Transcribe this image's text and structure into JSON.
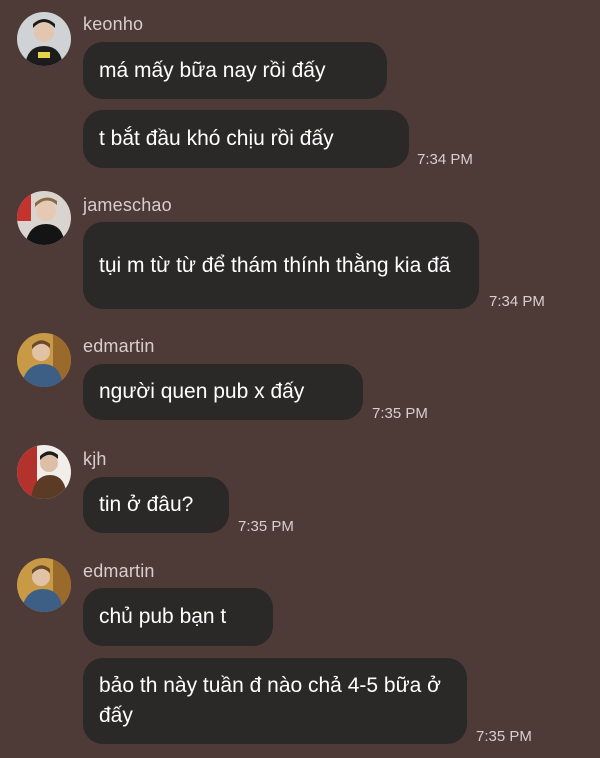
{
  "messages": [
    {
      "username": "keonho",
      "avatar_icon": "user-avatar-keonho",
      "bubbles": [
        "má mấy bữa nay rồi đấy",
        "t bắt đầu khó chịu rồi đấy"
      ],
      "time": "7:34 PM"
    },
    {
      "username": "jameschao",
      "avatar_icon": "user-avatar-jameschao",
      "bubbles": [
        "tụi m từ từ để thám thính thằng kia đã"
      ],
      "time": "7:34 PM"
    },
    {
      "username": "edmartin",
      "avatar_icon": "user-avatar-edmartin",
      "bubbles": [
        "người quen pub x đấy"
      ],
      "time": "7:35 PM"
    },
    {
      "username": "kjh",
      "avatar_icon": "user-avatar-kjh",
      "bubbles": [
        "tin ở đâu?"
      ],
      "time": "7:35 PM"
    },
    {
      "username": "edmartin",
      "avatar_icon": "user-avatar-edmartin",
      "bubbles": [
        "chủ pub bạn t",
        "bảo th này tuần đ nào chả 4-5 bữa ở đấy"
      ],
      "time": "7:35 PM"
    }
  ],
  "colors": {
    "background": "#4e3a36",
    "bubble": "#2b2828",
    "meta_text": "#d8cfcc"
  }
}
